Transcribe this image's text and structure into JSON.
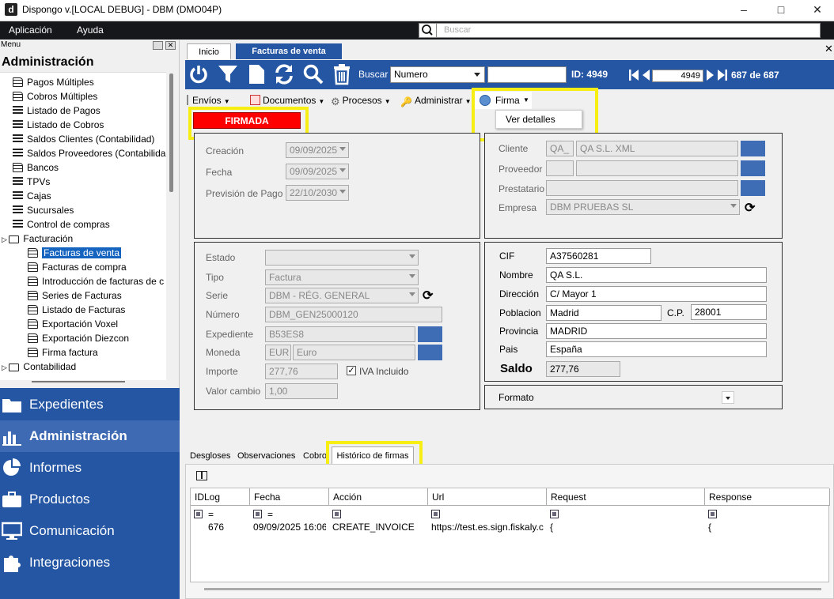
{
  "window": {
    "title": "Dispongo v.[LOCAL DEBUG] - DBM (DMO04P)",
    "app_icon": "d"
  },
  "menubar": {
    "items": [
      "Aplicación",
      "Ayuda"
    ],
    "search_placeholder": "Buscar"
  },
  "sidebar": {
    "menu_label": "Menu",
    "title": "Administración",
    "tree": [
      {
        "label": "Pagos Múltiples",
        "icon": "users-icon"
      },
      {
        "label": "Cobros Múltiples",
        "icon": "doc-icon"
      },
      {
        "label": "Listado de Pagos",
        "icon": "list-icon"
      },
      {
        "label": "Listado de Cobros",
        "icon": "list-icon"
      },
      {
        "label": "Saldos Clientes (Contabilidad)",
        "icon": "list-icon"
      },
      {
        "label": "Saldos Proveedores (Contabilida",
        "icon": "list-icon"
      },
      {
        "label": "Bancos",
        "icon": "bank-icon"
      },
      {
        "label": "TPVs",
        "icon": "list-icon"
      },
      {
        "label": "Cajas",
        "icon": "list-icon"
      },
      {
        "label": "Sucursales",
        "icon": "list-icon"
      },
      {
        "label": "Control de compras",
        "icon": "list-icon"
      },
      {
        "label": "Facturación",
        "icon": "folder-icon"
      },
      {
        "label": "Facturas de venta",
        "icon": "doc-icon"
      },
      {
        "label": "Facturas de compra",
        "icon": "doc-icon"
      },
      {
        "label": "Introducción de facturas de c",
        "icon": "doc-icon"
      },
      {
        "label": "Series de Facturas",
        "icon": "doc-icon"
      },
      {
        "label": "Listado de Facturas",
        "icon": "doc-icon"
      },
      {
        "label": "Exportación Voxel",
        "icon": "doc-icon"
      },
      {
        "label": "Exportación Diezcon",
        "icon": "doc-icon"
      },
      {
        "label": "Firma factura",
        "icon": "doc-icon"
      },
      {
        "label": "Contabilidad",
        "icon": "folder-icon"
      }
    ],
    "nav": [
      {
        "label": "Expedientes",
        "icon": "folder-icon"
      },
      {
        "label": "Administración",
        "icon": "bar-chart-icon"
      },
      {
        "label": "Informes",
        "icon": "pie-chart-icon"
      },
      {
        "label": "Productos",
        "icon": "briefcase-icon"
      },
      {
        "label": "Comunicación",
        "icon": "monitor-icon"
      },
      {
        "label": "Integraciones",
        "icon": "puzzle-icon"
      }
    ]
  },
  "tabs": {
    "inicio": "Inicio",
    "facturas": "Facturas de venta"
  },
  "toolbar": {
    "buscar_label": "Buscar",
    "buscar_field": "Numero",
    "id_label": "ID: 4949",
    "record": "4949",
    "record_count": "687 de 687"
  },
  "actions": {
    "envios": "Envíos",
    "documentos": "Documentos",
    "procesos": "Procesos",
    "administrar": "Administrar",
    "firma": "Firma",
    "ver_detalles": "Ver detalles"
  },
  "status_badge": "FIRMADA",
  "fechas": {
    "creacion_label": "Creación",
    "creacion": "09/09/2025",
    "fecha_label": "Fecha",
    "fecha": "09/09/2025",
    "prevision_label": "Previsión de Pago",
    "prevision": "22/10/2030"
  },
  "partes": {
    "cliente_label": "Cliente",
    "cliente_code": "QA_",
    "cliente_name": "QA S.L. XML",
    "proveedor_label": "Proveedor",
    "prestatario_label": "Prestatario",
    "empresa_label": "Empresa",
    "empresa": "DBM PRUEBAS SL"
  },
  "factura": {
    "estado_label": "Estado",
    "estado": "",
    "tipo_label": "Tipo",
    "tipo": "Factura",
    "serie_label": "Serie",
    "serie": "DBM - RÉG. GENERAL",
    "numero_label": "Número",
    "numero": "DBM_GEN25000120",
    "expediente_label": "Expediente",
    "expediente": "B53ES8",
    "moneda_label": "Moneda",
    "moneda_code": "EUR",
    "moneda_name": "Euro",
    "importe_label": "Importe",
    "importe": "277,76",
    "iva_label": "IVA Incluido",
    "valor_cambio_label": "Valor cambio",
    "valor_cambio": "1,00"
  },
  "cliente_datos": {
    "cif_label": "CIF",
    "cif": "A37560281",
    "nombre_label": "Nombre",
    "nombre": "QA S.L.",
    "direccion_label": "Dirección",
    "direccion": "C/ Mayor 1",
    "poblacion_label": "Poblacion",
    "poblacion": "Madrid",
    "cp_label": "C.P.",
    "cp": "28001",
    "provincia_label": "Provincia",
    "provincia": "MADRID",
    "pais_label": "Pais",
    "pais": "España",
    "saldo_label": "Saldo",
    "saldo": "277,76"
  },
  "formato_label": "Formato",
  "lower_tabs": [
    "Desgloses",
    "Observaciones",
    "Cobro",
    "Histórico de firmas"
  ],
  "grid": {
    "columns": [
      "IDLog",
      "Fecha",
      "Acción",
      "Url",
      "Request",
      "Response"
    ],
    "filter_eq": "=",
    "rows": [
      [
        "676",
        "09/09/2025 16:06",
        "CREATE_INVOICE",
        "https://test.es.sign.fiskaly.c...",
        "{",
        "{"
      ]
    ]
  }
}
